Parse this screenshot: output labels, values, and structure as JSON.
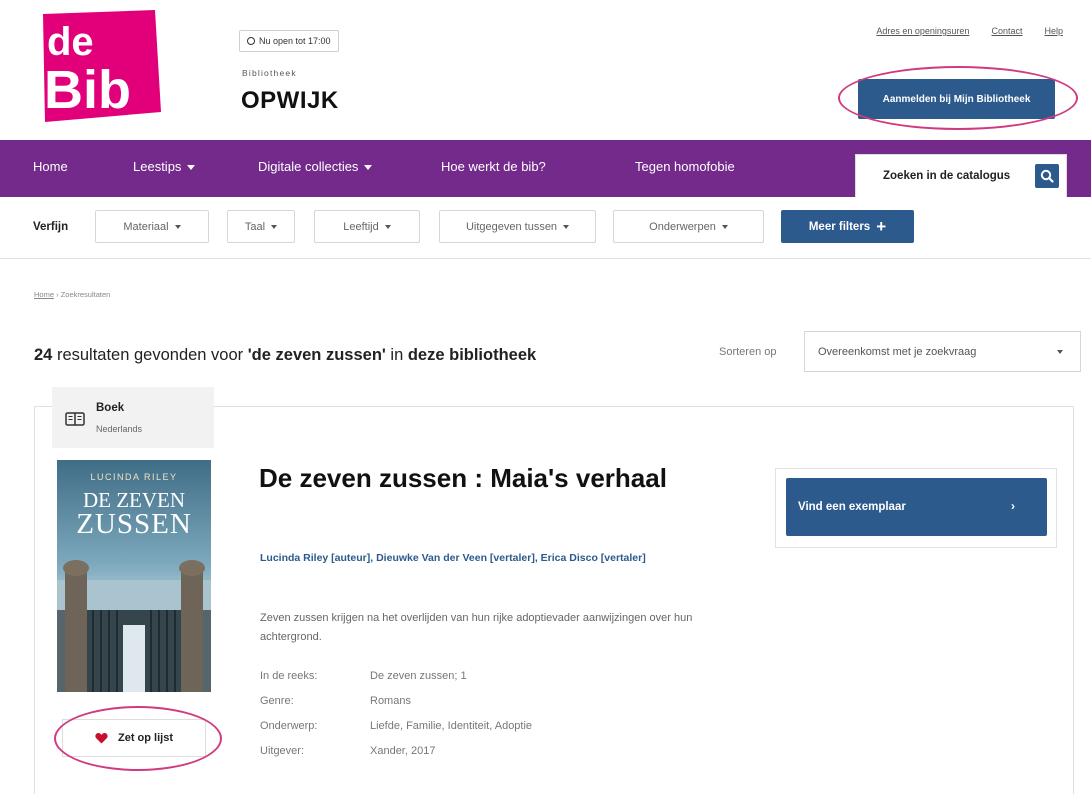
{
  "header": {
    "logo_text_top": "de",
    "logo_text_bottom": "Bib",
    "open_status": "Nu open tot 17:00",
    "library_label": "Bibliotheek",
    "library_name": "OPWIJK",
    "top_links": [
      "Adres en openingsuren",
      "Contact",
      "Help"
    ],
    "login_label": "Aanmelden bij Mijn Bibliotheek"
  },
  "nav": {
    "items": [
      {
        "label": "Home",
        "dropdown": false
      },
      {
        "label": "Leestips",
        "dropdown": true
      },
      {
        "label": "Digitale collecties",
        "dropdown": true
      },
      {
        "label": "Hoe werkt de bib?",
        "dropdown": false
      },
      {
        "label": "Tegen homofobie",
        "dropdown": false
      }
    ],
    "search_label": "Zoeken in de catalogus"
  },
  "filters": {
    "label": "Verfijn",
    "dropdowns": [
      "Materiaal",
      "Taal",
      "Leeftijd",
      "Uitgegeven tussen",
      "Onderwerpen"
    ],
    "more_label": "Meer filters"
  },
  "breadcrumb": {
    "home": "Home",
    "separator": "›",
    "current": "Zoekresultaten"
  },
  "results": {
    "count": "24",
    "text_pre": " resultaten gevonden voor ",
    "query": "'de zeven zussen'",
    "text_mid": " in ",
    "scope": "deze bibliotheek",
    "sort_label": "Sorteren op",
    "sort_value": "Overeenkomst met je zoekvraag"
  },
  "item": {
    "type": "Boek",
    "language": "Nederlands",
    "cover_author": "LUCINDA RILEY",
    "cover_title_1": "DE ZEVEN",
    "cover_title_2": "ZUSSEN",
    "title": "De zeven zussen : Maia's verhaal",
    "authors": "Lucinda Riley [auteur], Dieuwke Van der Veen [vertaler], Erica Disco [vertaler]",
    "summary": "Zeven zussen krijgen na het overlijden van hun rijke adoptievader aanwijzingen over hun achtergrond.",
    "meta": [
      {
        "key": "In de reeks:",
        "value": "De zeven zussen; 1"
      },
      {
        "key": "Genre:",
        "value": "Romans"
      },
      {
        "key": "Onderwerp:",
        "value": "Liefde, Familie, Identiteit, Adoptie"
      },
      {
        "key": "Uitgever:",
        "value": "Xander, 2017"
      }
    ],
    "list_button": "Zet op lijst",
    "find_button": "Vind een exemplaar"
  },
  "colors": {
    "brand_pink": "#e2007a",
    "nav_purple": "#742a8a",
    "button_blue": "#2c5a8c",
    "annotation_circle": "#d13a7e"
  }
}
